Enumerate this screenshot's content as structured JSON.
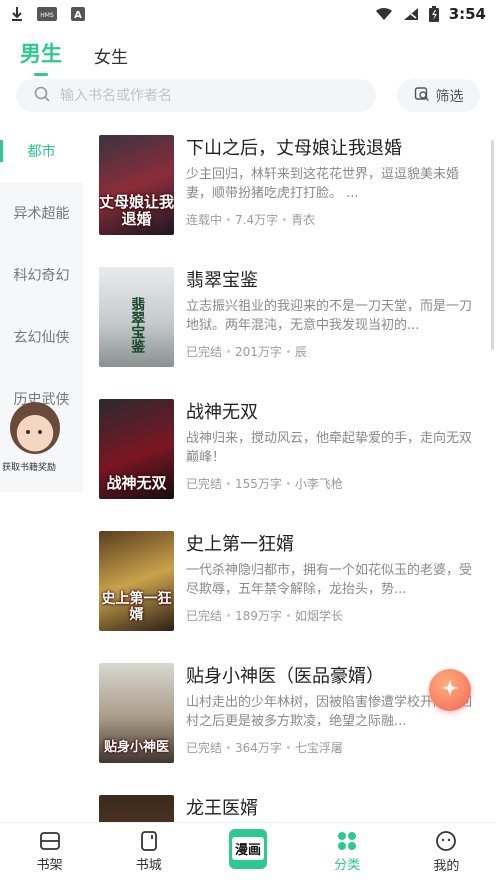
{
  "status_bar": {
    "time": "3:54",
    "icons": [
      "download-icon",
      "hms-icon",
      "a-icon",
      "wifi-icon",
      "signal-icon",
      "battery-icon"
    ],
    "hms_label": "HMS",
    "a_label": "A"
  },
  "gender_tabs": [
    {
      "label": "男生",
      "active": true
    },
    {
      "label": "女生",
      "active": false
    }
  ],
  "search": {
    "placeholder": "输入书名或作者名"
  },
  "filter": {
    "label": "筛选"
  },
  "sidebar": {
    "items": [
      {
        "label": "都市",
        "active": true
      },
      {
        "label": "异术超能",
        "active": false
      },
      {
        "label": "科幻奇幻",
        "active": false
      },
      {
        "label": "玄幻仙侠",
        "active": false
      },
      {
        "label": "历史武侠",
        "active": false
      }
    ],
    "promo": {
      "text": "获取书籍奖励"
    }
  },
  "books": [
    {
      "title": "下山之后，丈母娘让我退婚",
      "desc": "少主回归，林轩来到这花花世界，逗逗貌美未婚妻，顺带扮猪吃虎打打脸。 ...",
      "status": "连载中",
      "words": "7.4万字",
      "author": "青衣",
      "cover_text": "丈母娘让我退婚"
    },
    {
      "title": "翡翠宝鉴",
      "desc": "立志振兴祖业的我迎来的不是一刀天堂，而是一刀地狱。两年混沌，无意中我发现当初的...",
      "status": "已完结",
      "words": "201万字",
      "author": "辰",
      "cover_text": "翡翠宝鉴"
    },
    {
      "title": "战神无双",
      "desc": "战神归来，搅动风云，他牵起挚爱的手，走向无双巅峰！",
      "status": "已完结",
      "words": "155万字",
      "author": "小李飞枪",
      "cover_text": "战神无双"
    },
    {
      "title": "史上第一狂婿",
      "desc": "一代杀神隐归都市，拥有一个如花似玉的老婆，受尽欺辱，五年禁令解除，龙抬头，势...",
      "status": "已完结",
      "words": "189万字",
      "author": "如烟学长",
      "cover_text": "史上第一狂婿"
    },
    {
      "title": "贴身小神医（医品豪婿）",
      "desc": "山村走出的少年林树，因被陷害惨遭学校开除，回村之后更是被多方欺凌，绝望之际融...",
      "status": "已完结",
      "words": "364万字",
      "author": "七宝浮屠",
      "cover_text": "贴身小神医"
    },
    {
      "title": "龙王医婿",
      "desc": "",
      "status": "",
      "words": "",
      "author": "",
      "cover_text": ""
    }
  ],
  "bottom_nav": [
    {
      "label": "书架",
      "icon": "bookshelf-icon",
      "active": false
    },
    {
      "label": "书城",
      "icon": "bookstore-icon",
      "active": false
    },
    {
      "label": "漫画",
      "icon": "manga-icon",
      "active": false
    },
    {
      "label": "分类",
      "icon": "category-icon",
      "active": true
    },
    {
      "label": "我的",
      "icon": "profile-icon",
      "active": false
    }
  ],
  "colors": {
    "accent": "#2ec98e",
    "text": "#222222",
    "muted": "#9c9c9c",
    "sidebar_bg": "#f6f7f9",
    "search_bg": "#f4f5f7",
    "float_button": "#f2645a"
  }
}
